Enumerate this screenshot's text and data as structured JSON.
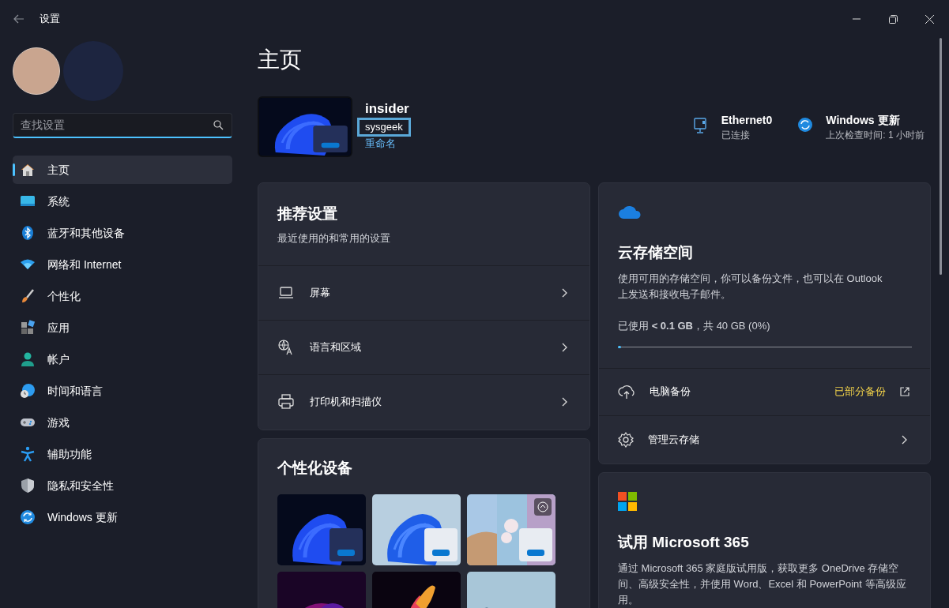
{
  "window": {
    "title": "设置"
  },
  "search": {
    "placeholder": "查找设置"
  },
  "sidebar": {
    "items": [
      {
        "label": "主页",
        "selected": true
      },
      {
        "label": "系统",
        "selected": false
      },
      {
        "label": "蓝牙和其他设备",
        "selected": false
      },
      {
        "label": "网络和 Internet",
        "selected": false
      },
      {
        "label": "个性化",
        "selected": false
      },
      {
        "label": "应用",
        "selected": false
      },
      {
        "label": "帐户",
        "selected": false
      },
      {
        "label": "时间和语言",
        "selected": false
      },
      {
        "label": "游戏",
        "selected": false
      },
      {
        "label": "辅助功能",
        "selected": false
      },
      {
        "label": "隐私和安全性",
        "selected": false
      },
      {
        "label": "Windows 更新",
        "selected": false
      }
    ]
  },
  "page_title": "主页",
  "account": {
    "name": "insider",
    "email": "sysgeek",
    "rename": "重命名"
  },
  "status": [
    {
      "title": "Ethernet0",
      "subtitle": "已连接"
    },
    {
      "title": "Windows 更新",
      "subtitle": "上次检查时间: 1 小时前"
    }
  ],
  "recommended": {
    "title": "推荐设置",
    "subtitle": "最近使用的和常用的设置",
    "items": [
      {
        "label": "屏幕"
      },
      {
        "label": "语言和区域"
      },
      {
        "label": "打印机和扫描仪"
      }
    ]
  },
  "personalize": {
    "title": "个性化设备"
  },
  "cloud": {
    "title": "云存储空间",
    "description": "使用可用的存储空间，你可以备份文件，也可以在 Outlook 上发送和接收电子邮件。",
    "usage": "已使用 **< 0.1 GB**，共 40 GB (0%)",
    "level": 0.01,
    "rows": [
      {
        "kind": "link",
        "label": "电脑备份",
        "status": "已部分备份"
      },
      {
        "kind": "chevron",
        "label": "管理云存储"
      }
    ]
  },
  "m365": {
    "title": "试用 Microsoft 365",
    "description": "通过 Microsoft 365 家庭版试用版，获取更多 OneDrive 存储空间、高级安全性，并使用 Word、Excel 和 PowerPoint 等高级应用。"
  }
}
